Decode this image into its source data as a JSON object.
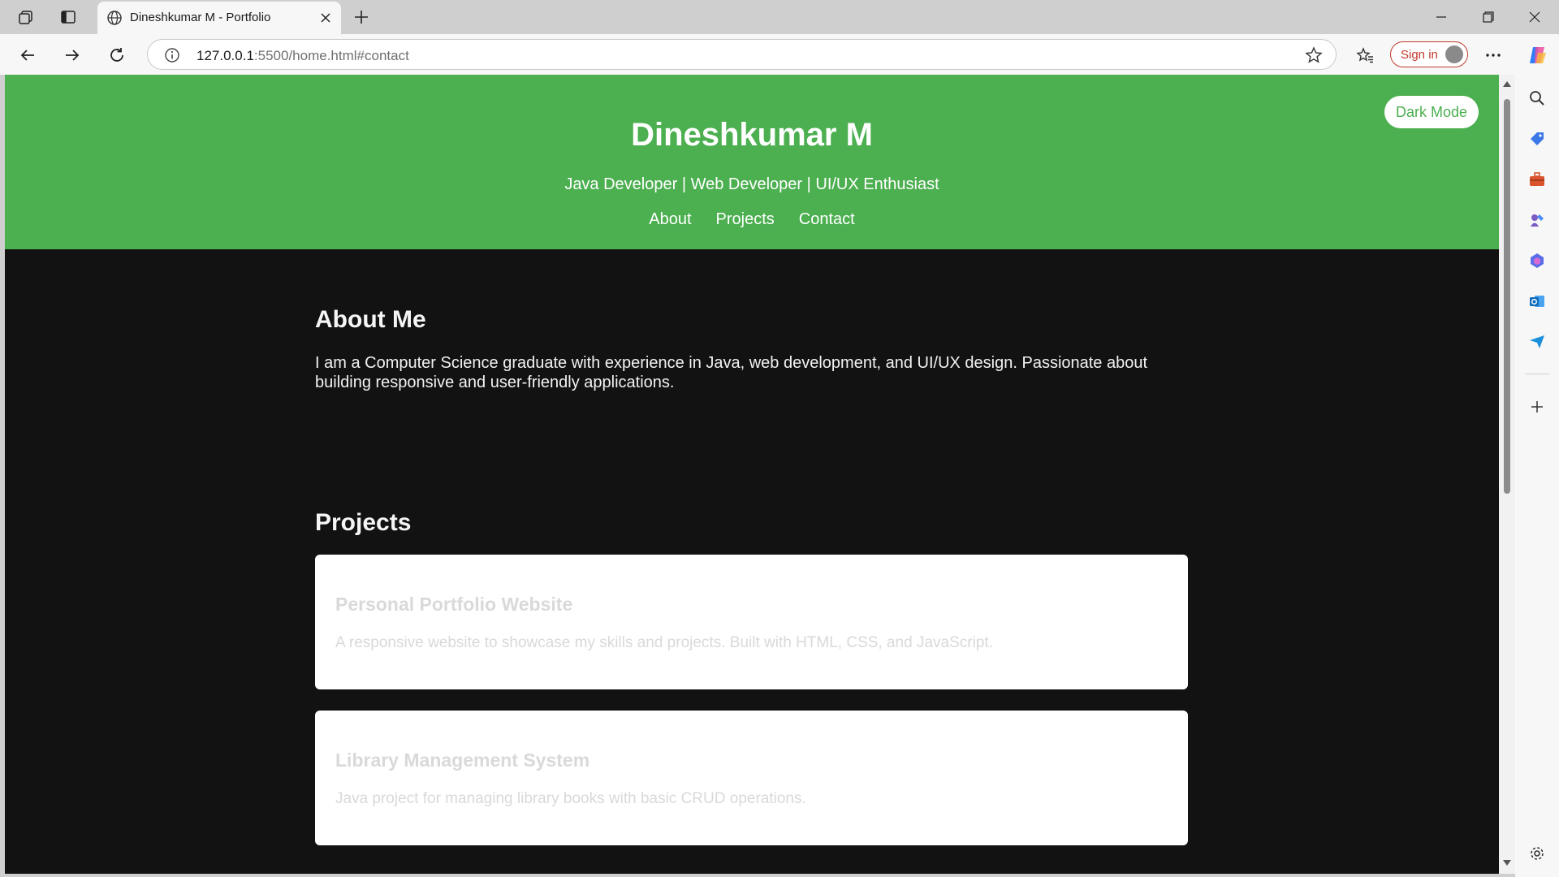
{
  "browser": {
    "tab_title": "Dineshkumar M - Portfolio",
    "url_host": "127.0.0.1",
    "url_rest": ":5500/home.html#contact",
    "signin_label": "Sign in"
  },
  "site": {
    "title": "Dineshkumar M",
    "tagline": "Java Developer | Web Developer | UI/UX Enthusiast",
    "nav": [
      "About",
      "Projects",
      "Contact"
    ],
    "dark_mode_label": "Dark Mode",
    "accent_color": "#4caf50"
  },
  "about": {
    "heading": "About Me",
    "text": "I am a Computer Science graduate with experience in Java, web development, and UI/UX design. Passionate about building responsive and user-friendly applications."
  },
  "projects": {
    "heading": "Projects",
    "items": [
      {
        "title": "Personal Portfolio Website",
        "description": "A responsive website to showcase my skills and projects. Built with HTML, CSS, and JavaScript."
      },
      {
        "title": "Library Management System",
        "description": "Java project for managing library books with basic CRUD operations."
      }
    ]
  }
}
